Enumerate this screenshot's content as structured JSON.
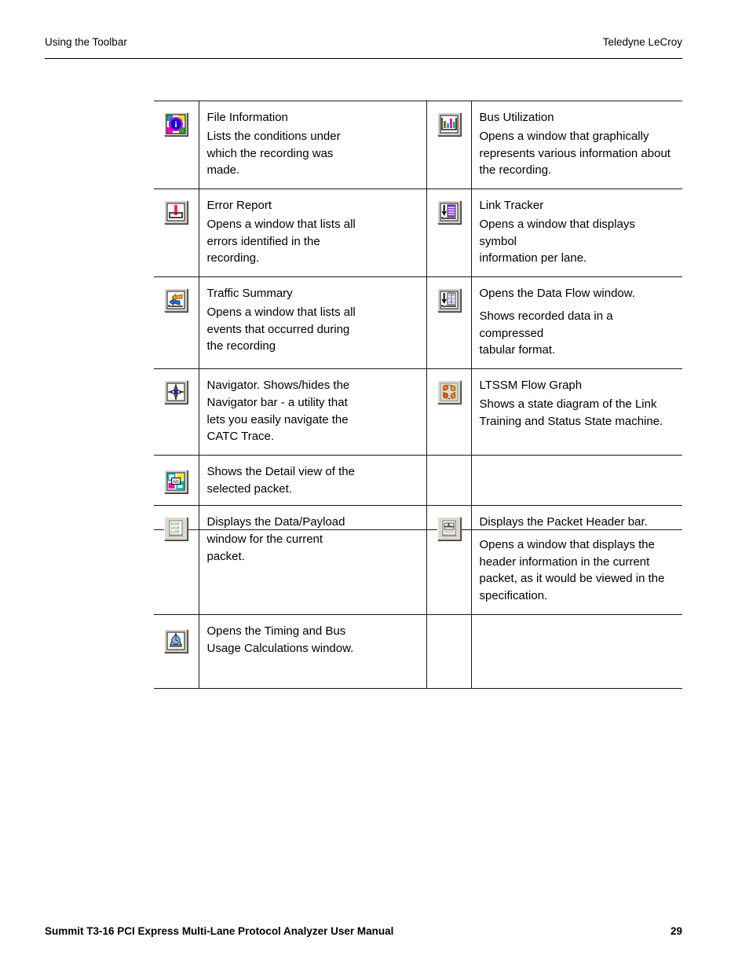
{
  "header": {
    "left": "Using the Toolbar",
    "right": "Teledyne LeCroy"
  },
  "footer": {
    "title": "Summit T3-16 PCI Express Multi-Lane Protocol Analyzer User Manual",
    "page": "29"
  },
  "tables": [
    {
      "id": "table-one",
      "rows": [
        {
          "left": {
            "icon": "file-information-icon",
            "title": "File Information",
            "lines": [
              "Lists the conditions under",
              "which the recording was",
              "made."
            ]
          },
          "right": {
            "icon": "bus-utilization-icon",
            "title": "Bus Utilization",
            "lines": [
              "Opens a window that graphically",
              "represents various information about",
              "the recording."
            ]
          }
        },
        {
          "left": {
            "icon": "error-report-icon",
            "title": "Error Report",
            "lines": [
              "Opens a window that lists all",
              "errors identified in the",
              "recording."
            ]
          },
          "right": {
            "icon": "link-tracker-icon",
            "title": "Link Tracker",
            "lines": [
              "Opens a window that displays symbol",
              "information per lane."
            ]
          }
        },
        {
          "left": {
            "icon": "traffic-summary-icon",
            "title": "Traffic Summary",
            "lines": [
              "Opens a window that lists all",
              "events that occurred during",
              "the recording"
            ]
          },
          "right": {
            "icon": "data-flow-icon",
            "title": "",
            "lines": [
              "Opens the Data Flow window.",
              "Shows recorded data in a compressed",
              "tabular format."
            ]
          }
        },
        {
          "left": {
            "icon": "navigator-icon",
            "title": "",
            "lines": [
              "Navigator. Shows/hides the",
              "Navigator bar - a utility that",
              "lets you easily navigate the",
              "CATC Trace."
            ]
          },
          "right": {
            "icon": "ltssm-flow-graph-icon",
            "title": "LTSSM Flow Graph",
            "lines": [
              "Shows a state diagram of the Link",
              "Training and Status State machine."
            ]
          }
        },
        {
          "left": {
            "icon": "detail-view-icon",
            "title": "",
            "lines": [
              "Shows the Detail view of the",
              "selected packet."
            ]
          },
          "right": {
            "icon": "",
            "title": "",
            "lines": []
          }
        }
      ]
    },
    {
      "id": "table-two",
      "rows": [
        {
          "left": {
            "icon": "data-payload-icon",
            "title": "",
            "lines": [
              "Displays the Data/Payload",
              "window for the current",
              "packet."
            ]
          },
          "right": {
            "icon": "packet-header-bar-icon",
            "title": "",
            "lines": [
              "Displays the Packet Header bar.",
              "Opens a window that displays the",
              "header information in the current",
              "packet, as it would be viewed in the",
              "specification."
            ]
          }
        },
        {
          "left": {
            "icon": "timing-bus-usage-icon",
            "title": "",
            "lines": [
              "Opens the Timing and Bus",
              "Usage Calculations window."
            ]
          },
          "right": {
            "icon": "",
            "title": "",
            "lines": []
          }
        }
      ]
    }
  ]
}
